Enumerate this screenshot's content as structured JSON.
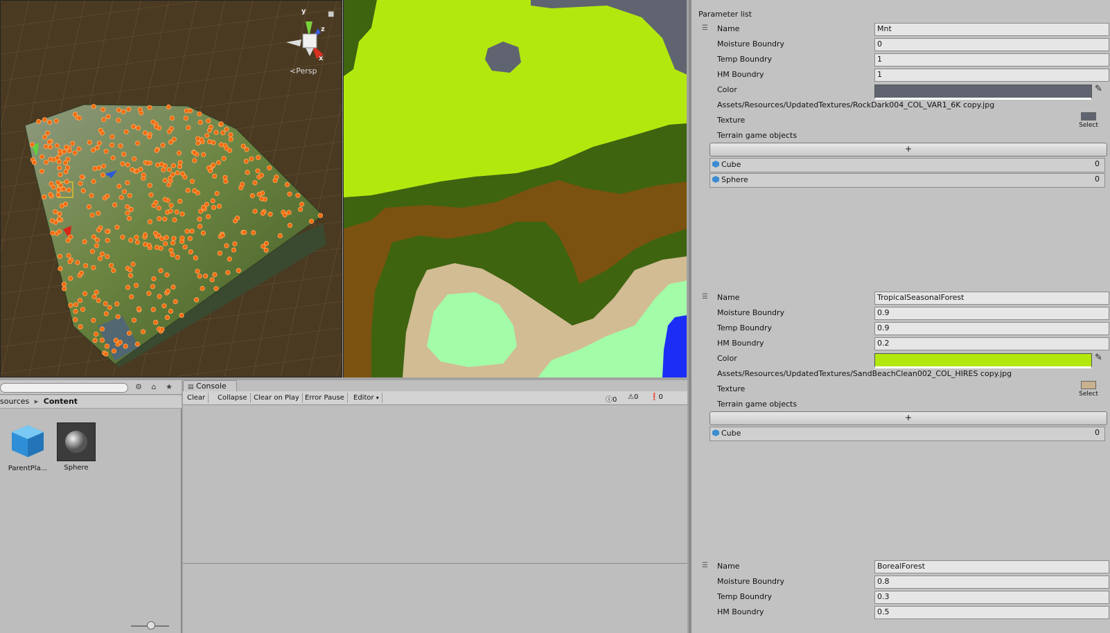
{
  "scene": {
    "persp_label": "Persp",
    "axes": {
      "x": "x",
      "y": "y",
      "z": "z"
    }
  },
  "project": {
    "breadcrumb": {
      "parent": "sources",
      "separator": "▸",
      "current": "Content"
    },
    "assets": [
      {
        "label": "ParentPla..."
      },
      {
        "label": "Sphere"
      }
    ]
  },
  "console": {
    "tab_label": "Console",
    "toolbar": {
      "clear": "Clear",
      "collapse": "Collapse",
      "clear_on_play": "Clear on Play",
      "error_pause": "Error Pause",
      "editor": "Editor"
    },
    "counts": {
      "info": "0",
      "warning": "0",
      "error": "0"
    }
  },
  "inspector": {
    "header": "Parameter list",
    "labels": {
      "name": "Name",
      "moisture": "Moisture Boundry",
      "temp": "Temp Boundry",
      "hm": "HM Boundry",
      "color": "Color",
      "texture": "Texture",
      "terrain_objects": "Terrain game objects",
      "select": "Select",
      "add": "+"
    },
    "entries": [
      {
        "name": "Mnt",
        "moisture": "0",
        "temp": "1",
        "hm": "1",
        "color": "#5f6470",
        "texture_path": "Assets/Resources/UpdatedTextures/RockDark004_COL_VAR1_6K copy.jpg",
        "objects": [
          "Cube",
          "Sphere"
        ],
        "object_counts": [
          "0",
          "0"
        ]
      },
      {
        "name": "TropicalSeasonalForest",
        "moisture": "0.9",
        "temp": "0.9",
        "hm": "0.2",
        "color": "#b3e80f",
        "texture_path": "Assets/Resources/UpdatedTextures/SandBeachClean002_COL_HIRES copy.jpg",
        "objects": [
          "Cube"
        ],
        "object_counts": [
          "0"
        ]
      },
      {
        "name": "BorealForest",
        "moisture": "0.8",
        "temp": "0.3",
        "hm": "0.5"
      }
    ]
  },
  "colors": {
    "biome_mountain": "#5f6470",
    "biome_tropical": "#b3e80f",
    "biome_forest": "#3e6410",
    "biome_dirt": "#7b520f",
    "biome_sand": "#d2bc94",
    "biome_mint": "#a2fca8",
    "biome_water": "#1c2ef6"
  }
}
